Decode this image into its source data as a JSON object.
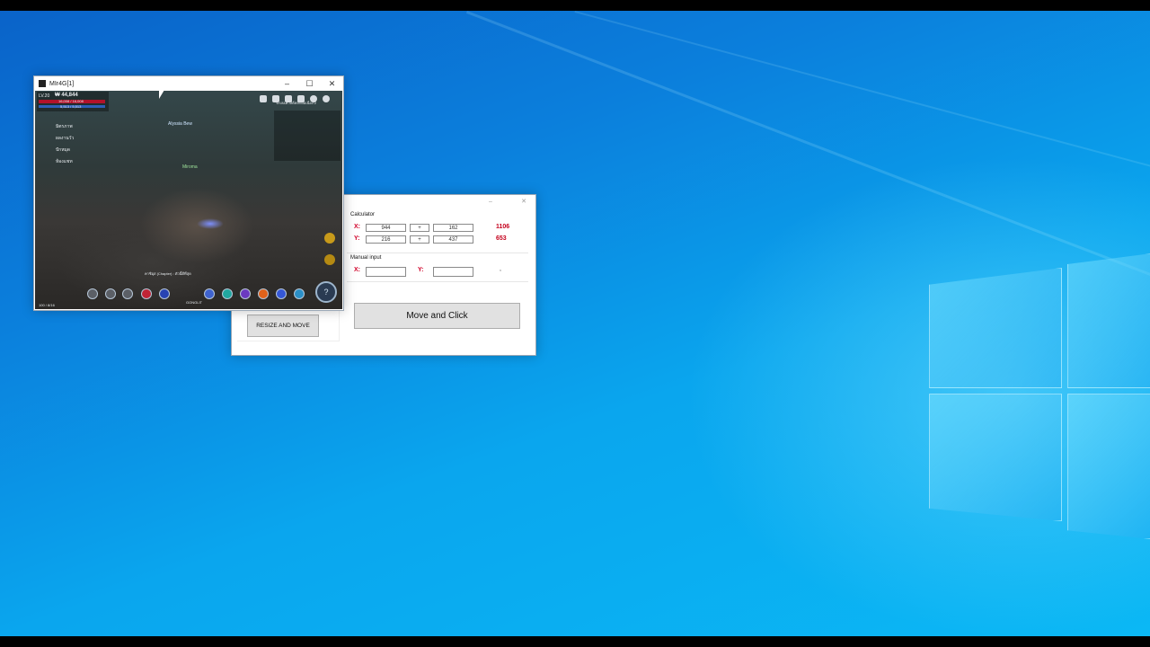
{
  "desktop": {
    "background_accent": "#0b8fe6"
  },
  "game_window": {
    "title": "MIr4G[1]",
    "controls": {
      "minimize": "–",
      "maximize": "☐",
      "close": "✕"
    },
    "hud": {
      "level": "LV.20",
      "power": "₩ 44,844",
      "hp": "16,008 / 16,008",
      "mp": "5,513 / 5,513",
      "menu_items": [
        "มิตรภาพ",
        "ผลงานวัว",
        "ปักหมุด",
        "ห้องแชท"
      ],
      "player_tag": "Miroma",
      "nearby_name": "Alyssia Bew",
      "quest_title": "ระบบเควสต์หลักต่อเนื่อง 2",
      "chat_line": "คาชิอุส (Chapter) : ตัวนี้ดีที่สุด",
      "bottom_label": "GONGLIT",
      "stat_line": "100 / 8/16",
      "question_icon": "?"
    }
  },
  "calculator_window": {
    "controls": {
      "minimize": "–",
      "close": "✕"
    },
    "calculator": {
      "label": "Calculator",
      "x_label": "X:",
      "y_label": "Y:",
      "x_a": "944",
      "x_op": "+",
      "x_b": "162",
      "x_result": "1106",
      "y_a": "216",
      "y_op": "+",
      "y_b": "437",
      "y_result": "653"
    },
    "manual": {
      "label": "Manual input",
      "x_label": "X:",
      "y_label": "Y:",
      "x_value": "",
      "y_value": "",
      "separator": ","
    },
    "move_click_label": "Move and Click",
    "resize_move_label": "RESIZE AND MOVE"
  }
}
